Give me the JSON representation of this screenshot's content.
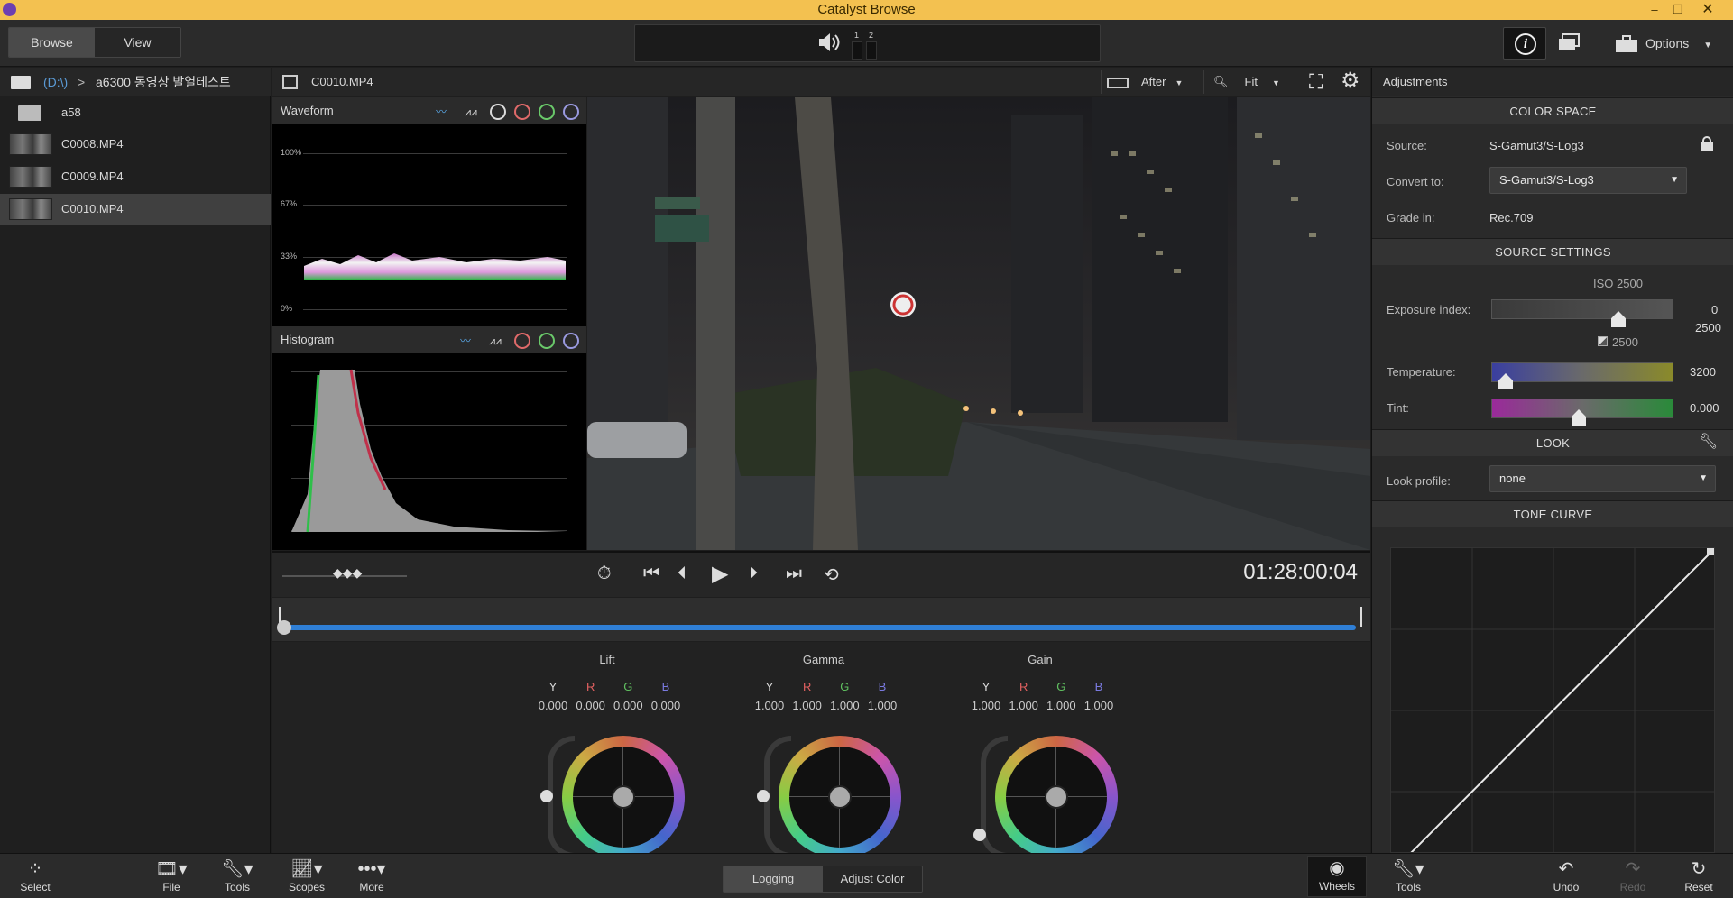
{
  "window": {
    "title": "Catalyst Browse",
    "min": "–",
    "restore": "❐",
    "close": "✕"
  },
  "toolbar": {
    "browse": "Browse",
    "view": "View",
    "ch1": "1",
    "ch2": "2",
    "options": "Options"
  },
  "breadcrumb": {
    "drive": "(D:\\)",
    "sep": ">",
    "folder": "a6300 동영상 발열테스트"
  },
  "files": [
    {
      "name": "a58"
    },
    {
      "name": "C0008.MP4"
    },
    {
      "name": "C0009.MP4"
    },
    {
      "name": "C0010.MP4"
    }
  ],
  "clip": {
    "name": "C0010.MP4",
    "compare": "After",
    "zoom": "Fit"
  },
  "scopes": {
    "waveform": "Waveform",
    "histogram": "Histogram",
    "ticks": [
      "100%",
      "67%",
      "33%",
      "0%"
    ]
  },
  "transport": {
    "timecode": "01:28:00:04"
  },
  "wheels": [
    {
      "title": "Lift",
      "y": "0.000",
      "r": "0.000",
      "g": "0.000",
      "b": "0.000"
    },
    {
      "title": "Gamma",
      "y": "1.000",
      "r": "1.000",
      "g": "1.000",
      "b": "1.000"
    },
    {
      "title": "Gain",
      "y": "1.000",
      "r": "1.000",
      "g": "1.000",
      "b": "1.000"
    }
  ],
  "channels": {
    "y": "Y",
    "r": "R",
    "g": "G",
    "b": "B"
  },
  "adjustments": {
    "title": "Adjustments",
    "color_space": "COLOR SPACE",
    "source_label": "Source:",
    "source_value": "S-Gamut3/S-Log3",
    "convert_label": "Convert to:",
    "convert_value": "S-Gamut3/S-Log3",
    "grade_label": "Grade in:",
    "grade_value": "Rec.709",
    "source_settings": "SOURCE SETTINGS",
    "iso": "ISO 2500",
    "exposure_label": "Exposure index:",
    "exposure_value": "0",
    "exposure_value2": "2500",
    "exposure_sub": "2500",
    "temp_label": "Temperature:",
    "temp_value": "3200",
    "tint_label": "Tint:",
    "tint_value": "0.000",
    "look": "LOOK",
    "look_label": "Look profile:",
    "look_value": "none",
    "tone_curve": "TONE CURVE"
  },
  "bottom": {
    "select": "Select",
    "file": "File",
    "tools": "Tools",
    "scopes": "Scopes",
    "more": "More",
    "logging": "Logging",
    "adjust_color": "Adjust Color",
    "wheels": "Wheels",
    "tools2": "Tools",
    "undo": "Undo",
    "redo": "Redo",
    "reset": "Reset"
  }
}
